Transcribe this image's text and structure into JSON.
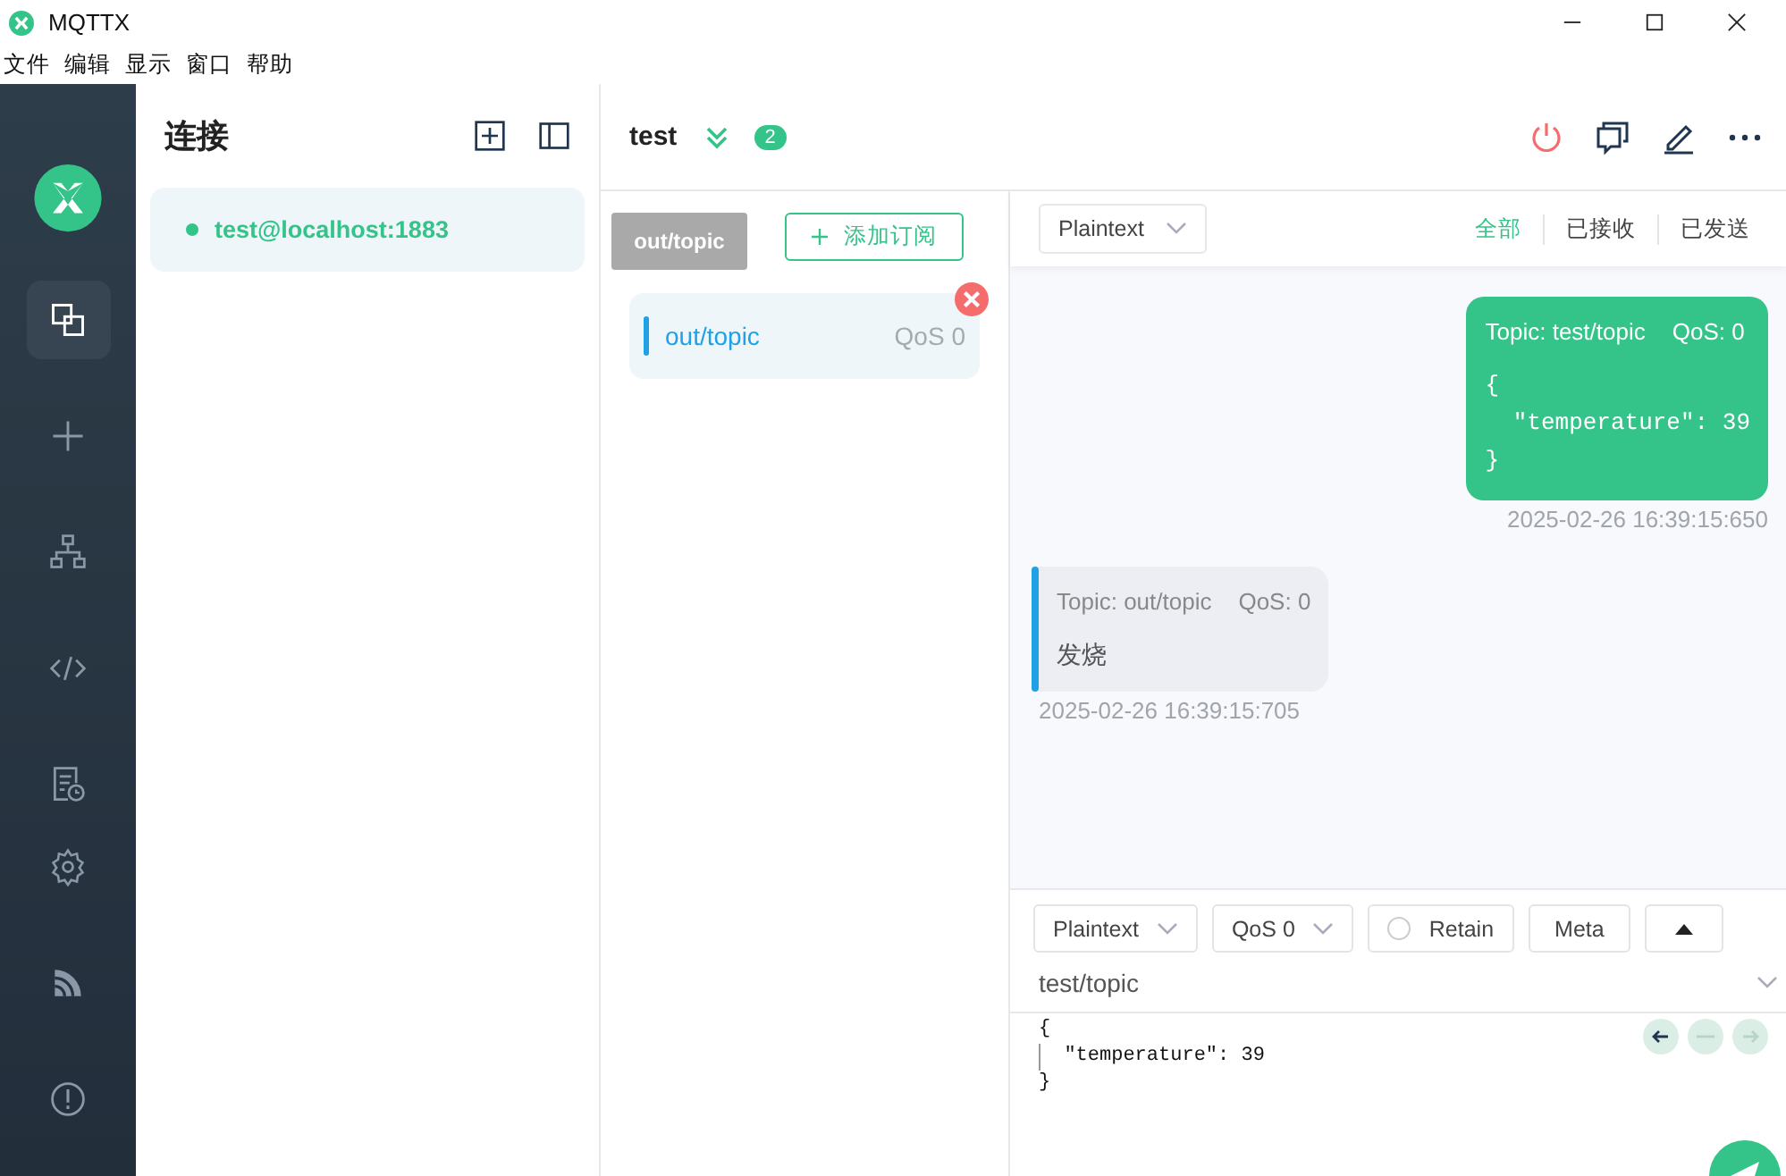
{
  "app": {
    "title": "MQTTX"
  },
  "menu": [
    "文件",
    "编辑",
    "显示",
    "窗口",
    "帮助"
  ],
  "sidebar": {
    "items": [
      {
        "kind": "connections",
        "selected": true
      },
      {
        "kind": "new",
        "selected": false
      },
      {
        "kind": "topology",
        "selected": false
      },
      {
        "kind": "script",
        "selected": false
      },
      {
        "kind": "log",
        "selected": false
      },
      {
        "kind": "settings",
        "selected": false
      },
      {
        "kind": "feed",
        "selected": false
      },
      {
        "kind": "about",
        "selected": false
      }
    ]
  },
  "connections": {
    "title": "连接",
    "items": [
      {
        "name": "test@localhost:1883",
        "connected": true,
        "selected": true
      }
    ]
  },
  "header": {
    "name": "test",
    "unread": "2"
  },
  "subscriptions": {
    "add_button": "添加订阅",
    "tooltip": "out/topic",
    "items": [
      {
        "topic": "out/topic",
        "qos": "QoS 0",
        "color": "#1ea1e5"
      }
    ]
  },
  "filter": {
    "format": "Plaintext",
    "tabs": [
      {
        "label": "全部",
        "selected": true
      },
      {
        "label": "已接收",
        "selected": false
      },
      {
        "label": "已发送",
        "selected": false
      }
    ]
  },
  "messages": [
    {
      "kind": "sent",
      "topic": "Topic: test/topic",
      "qos": "QoS: 0",
      "payload": "{\n  \"temperature\": 39\n}",
      "time": "2025-02-26 16:39:15:650"
    },
    {
      "kind": "received",
      "topic": "Topic: out/topic",
      "qos": "QoS: 0",
      "payload": "发烧",
      "time": "2025-02-26 16:39:15:705",
      "color": "#1ea1e5"
    }
  ],
  "composer": {
    "format": "Plaintext",
    "qos": "QoS 0",
    "retain": {
      "label": "Retain",
      "checked": false
    },
    "meta": "Meta",
    "topic": "test/topic",
    "payload_lines": [
      "{",
      "  \"temperature\": 39",
      "}"
    ]
  }
}
